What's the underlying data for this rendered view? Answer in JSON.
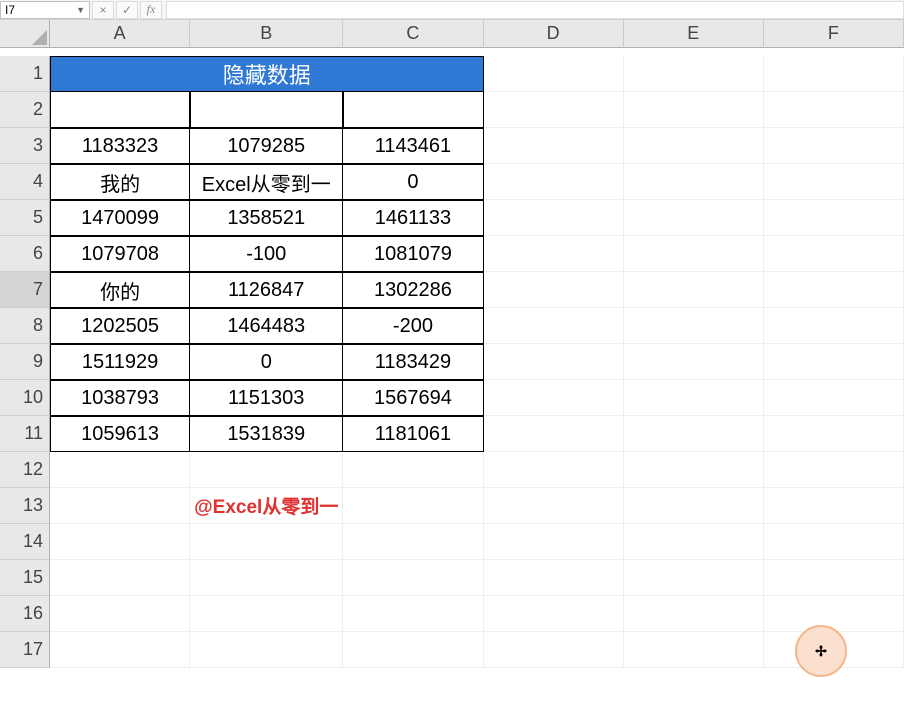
{
  "nameBox": "I7",
  "columns": [
    "A",
    "B",
    "C",
    "D",
    "E",
    "F"
  ],
  "rowCount": 17,
  "selectedRow": 7,
  "title": "隐藏数据",
  "table": [
    [
      "1183323",
      "1079285",
      "1143461"
    ],
    [
      "我的",
      "Excel从零到一",
      "0"
    ],
    [
      "1470099",
      "1358521",
      "1461133"
    ],
    [
      "1079708",
      "-100",
      "1081079"
    ],
    [
      "你的",
      "1126847",
      "1302286"
    ],
    [
      "1202505",
      "1464483",
      "-200"
    ],
    [
      "1511929",
      "0",
      "1183429"
    ],
    [
      "1038793",
      "1151303",
      "1567694"
    ],
    [
      "1059613",
      "1531839",
      "1181061"
    ]
  ],
  "watermark": "@Excel从零到一",
  "fbButtons": {
    "cancel": "×",
    "confirm": "✓",
    "fx": "fx"
  }
}
